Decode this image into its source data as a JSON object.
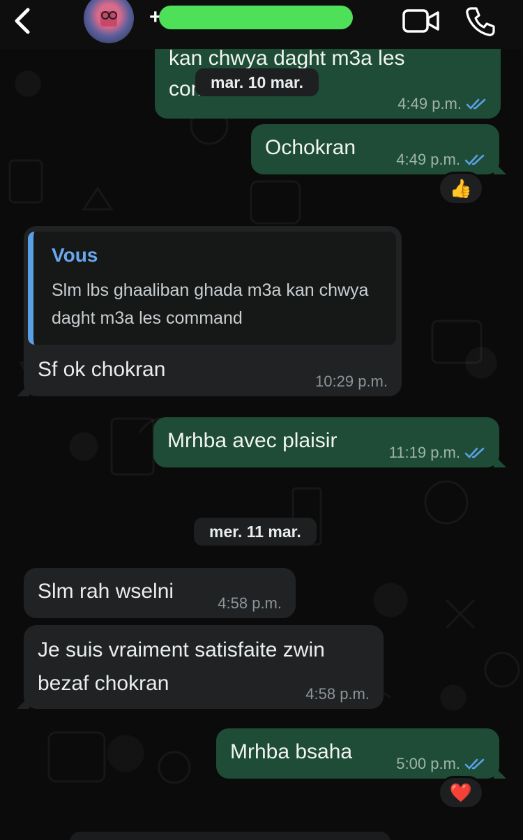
{
  "header": {
    "contact_prefix": "+2",
    "back_icon": "chevron-left-icon",
    "video_icon": "video-camera-icon",
    "call_icon": "phone-icon"
  },
  "colors": {
    "outgoing_bubble": "#1f4c36",
    "incoming_bubble": "#202223",
    "read_ticks": "#5aa0e6",
    "quote_accent": "#5aa0e6"
  },
  "messages": {
    "m1": {
      "text": "kan chwya daght m3a les command",
      "time": "4:49 p.m."
    },
    "m2": {
      "text": "Ochokran",
      "time": "4:49 p.m.",
      "reaction": "👍"
    },
    "m3": {
      "quote_author": "Vous",
      "quote_text": "Slm lbs ghaaliban ghada m3a kan chwya daght m3a les command",
      "text": "Sf ok chokran",
      "time": "10:29 p.m."
    },
    "m4": {
      "text": "Mrhba avec plaisir",
      "time": "11:19 p.m."
    },
    "m5": {
      "text": "Slm rah wselni",
      "time": "4:58 p.m."
    },
    "m6": {
      "text": "Je suis vraiment satisfaite zwin bezaf chokran",
      "time": "4:58 p.m."
    },
    "m7": {
      "text": "Mrhba bsaha",
      "time": "5:00 p.m.",
      "reaction": "❤️"
    }
  },
  "dates": {
    "d1": "mar. 10 mar.",
    "d2": "mer. 11 mar."
  }
}
